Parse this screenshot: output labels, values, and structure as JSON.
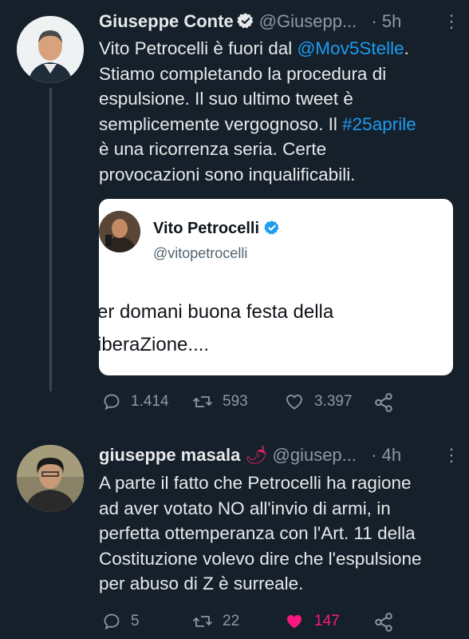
{
  "tweets": [
    {
      "name": "Giuseppe Conte",
      "handle": "@Giusepp...",
      "separator": "·",
      "time": "5h",
      "text_parts": [
        "Vito Petrocelli è fuori dal ",
        "@Mov5Stelle",
        ".\nStiamo completando la procedura di\nespulsione. Il suo ultimo tweet è\nsemplicemente vergognoso. Il ",
        "#25aprile",
        "\nè una ricorrenza seria. Certe\nprovocazioni sono inqualificabili."
      ],
      "quote": {
        "name": "Vito Petrocelli",
        "handle": "@vitopetrocelli",
        "text": "er domani buona festa della\niberaZione...."
      },
      "actions": {
        "replies": "1.414",
        "retweets": "593",
        "likes": "3.397"
      }
    },
    {
      "name": "giuseppe masala",
      "emoji": "🌶",
      "handle": "@giusep...",
      "separator": "·",
      "time": "4h",
      "text": "A parte il fatto che Petrocelli ha ragione\nad aver votato NO all'invio di armi, in\nperfetta ottemperanza con l'Art. 11 della\nCostituzione volevo dire che l'espulsione\nper abuso di Z è surreale.",
      "actions": {
        "replies": "5",
        "retweets": "22",
        "likes": "147"
      }
    }
  ],
  "more_label": "⋮",
  "colors": {
    "background": "#15202b",
    "link": "#1d9bf0",
    "verified": "#1d9bf0",
    "like": "#f91880",
    "muted": "#8b98a5"
  },
  "icons": [
    "verified-badge",
    "reply-icon",
    "retweet-icon",
    "like-icon",
    "share-icon",
    "more-icon"
  ]
}
